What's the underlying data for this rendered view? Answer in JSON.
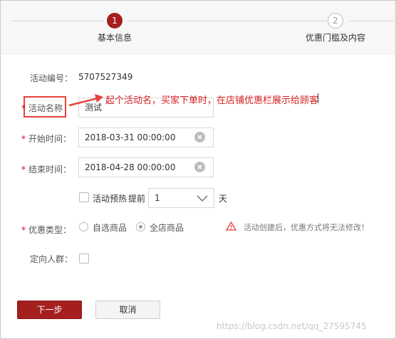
{
  "stepper": {
    "steps": [
      {
        "number": "1",
        "label": "基本信息"
      },
      {
        "number": "2",
        "label": "优惠门槛及内容"
      }
    ]
  },
  "form": {
    "activity_id": {
      "label": "活动编号：",
      "value": "5707527349"
    },
    "activity_name": {
      "label": "活动名称",
      "value": "测试"
    },
    "start_time": {
      "label": "开始时间：",
      "value": "2018-03-31 00:00:00"
    },
    "end_time": {
      "label": "结束时间：",
      "value": "2018-04-28 00:00:00"
    },
    "preheat": {
      "checkbox_label": "活动预热",
      "prefix": "提前",
      "value": "1",
      "suffix": "天"
    },
    "discount_type": {
      "label": "优惠类型：",
      "options": [
        "自选商品",
        "全店商品"
      ],
      "warning": "活动创建后，优惠方式将无法修改！"
    },
    "target_group": {
      "label": "定向人群："
    }
  },
  "annotation": {
    "text": "起个活动名，买家下单时，在店铺优惠栏展示给顾客"
  },
  "buttons": {
    "next": "下一步",
    "cancel": "取消"
  },
  "watermark": "https://blog.csdn.net/qq_27595745",
  "colors": {
    "primary": "#a51f1f",
    "annotation": "#e8413b",
    "required": "#d0021b"
  }
}
